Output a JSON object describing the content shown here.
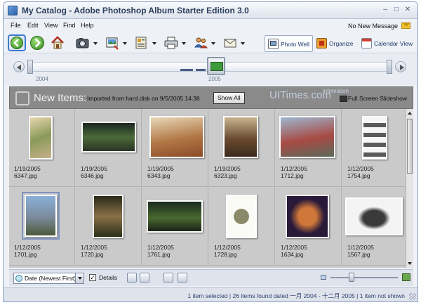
{
  "window": {
    "title": "My Catalog - Adobe Photoshop Album Starter Edition 3.0"
  },
  "menu": {
    "items": [
      "File",
      "Edit",
      "View",
      "Find",
      "Help"
    ],
    "message": "No New Message"
  },
  "toolbar": {
    "tabs": [
      {
        "label": "Photo Well",
        "active": true
      },
      {
        "label": "Organize",
        "active": false
      },
      {
        "label": "Calendar View",
        "active": false
      }
    ]
  },
  "timeline": {
    "labels": [
      "2004",
      "2005"
    ]
  },
  "new_items": {
    "title": "New Items:",
    "subtitle": "Imported from hard disk on 9/5/2005 14:38",
    "show_all": "Show All",
    "watermark": "UITimes.com",
    "watermark_sub": "infomation",
    "slideshow": "Full Screen Slideshow"
  },
  "photos": [
    {
      "date": "1/19/2005",
      "file": "6347.jpg"
    },
    {
      "date": "1/19/2005",
      "file": "6346.jpg"
    },
    {
      "date": "1/19/2005",
      "file": "6343.jpg"
    },
    {
      "date": "1/19/2005",
      "file": "6323.jpg"
    },
    {
      "date": "1/12/2005",
      "file": "1712.jpg"
    },
    {
      "date": "1/12/2005",
      "file": "1754.jpg"
    },
    {
      "date": "1/12/2005",
      "file": "1701.jpg"
    },
    {
      "date": "1/12/2005",
      "file": "1720.jpg"
    },
    {
      "date": "1/12/2005",
      "file": "1761.jpg"
    },
    {
      "date": "1/12/2005",
      "file": "1728.jpg"
    },
    {
      "date": "1/12/2005",
      "file": "1634.jpg"
    },
    {
      "date": "1/12/2005",
      "file": "1567.jpg"
    }
  ],
  "bottom": {
    "sort": "Date (Newest First)",
    "details_label": "Details",
    "details_checked": true
  },
  "status": {
    "text": "1 item selected | 26 items found dated 一月 2004 - 十二月 2005 | 1 item not shown"
  }
}
